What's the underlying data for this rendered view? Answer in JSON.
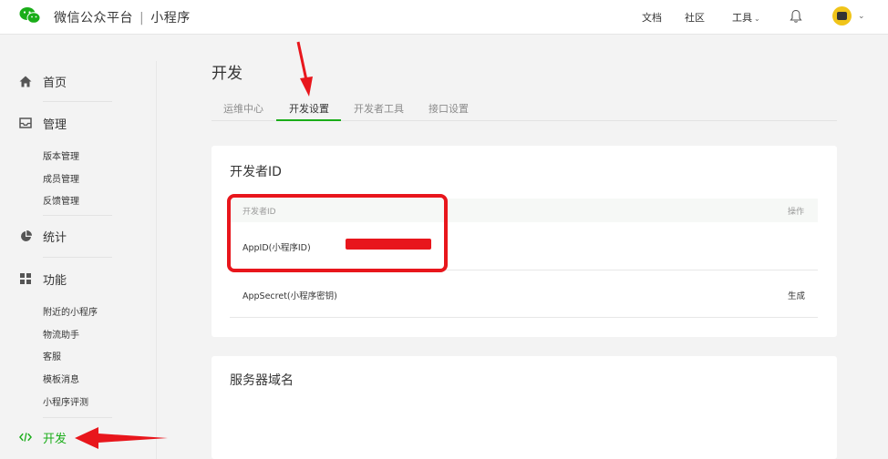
{
  "header": {
    "brand": "微信公众平台",
    "separator": "|",
    "product": "小程序",
    "nav": {
      "docs": "文档",
      "community": "社区",
      "tools": "工具"
    }
  },
  "sidebar": {
    "home": "首页",
    "manage": {
      "label": "管理",
      "items": [
        "版本管理",
        "成员管理",
        "反馈管理"
      ]
    },
    "stats": "统计",
    "features": {
      "label": "功能",
      "items": [
        "附近的小程序",
        "物流助手",
        "客服",
        "模板消息",
        "小程序评测"
      ]
    },
    "develop": "开发"
  },
  "main": {
    "title": "开发",
    "tabs": [
      "运维中心",
      "开发设置",
      "开发者工具",
      "接口设置"
    ],
    "active_tab": "开发设置",
    "developer_id": {
      "title": "开发者ID",
      "columns": {
        "id": "开发者ID",
        "action": "操作"
      },
      "rows": [
        {
          "label": "AppID(小程序ID)",
          "action": ""
        },
        {
          "label": "AppSecret(小程序密钥)",
          "action": "生成"
        }
      ]
    },
    "server_domain": {
      "title": "服务器域名"
    }
  },
  "colors": {
    "accent": "#1aad19",
    "annotation": "#e8161c"
  }
}
